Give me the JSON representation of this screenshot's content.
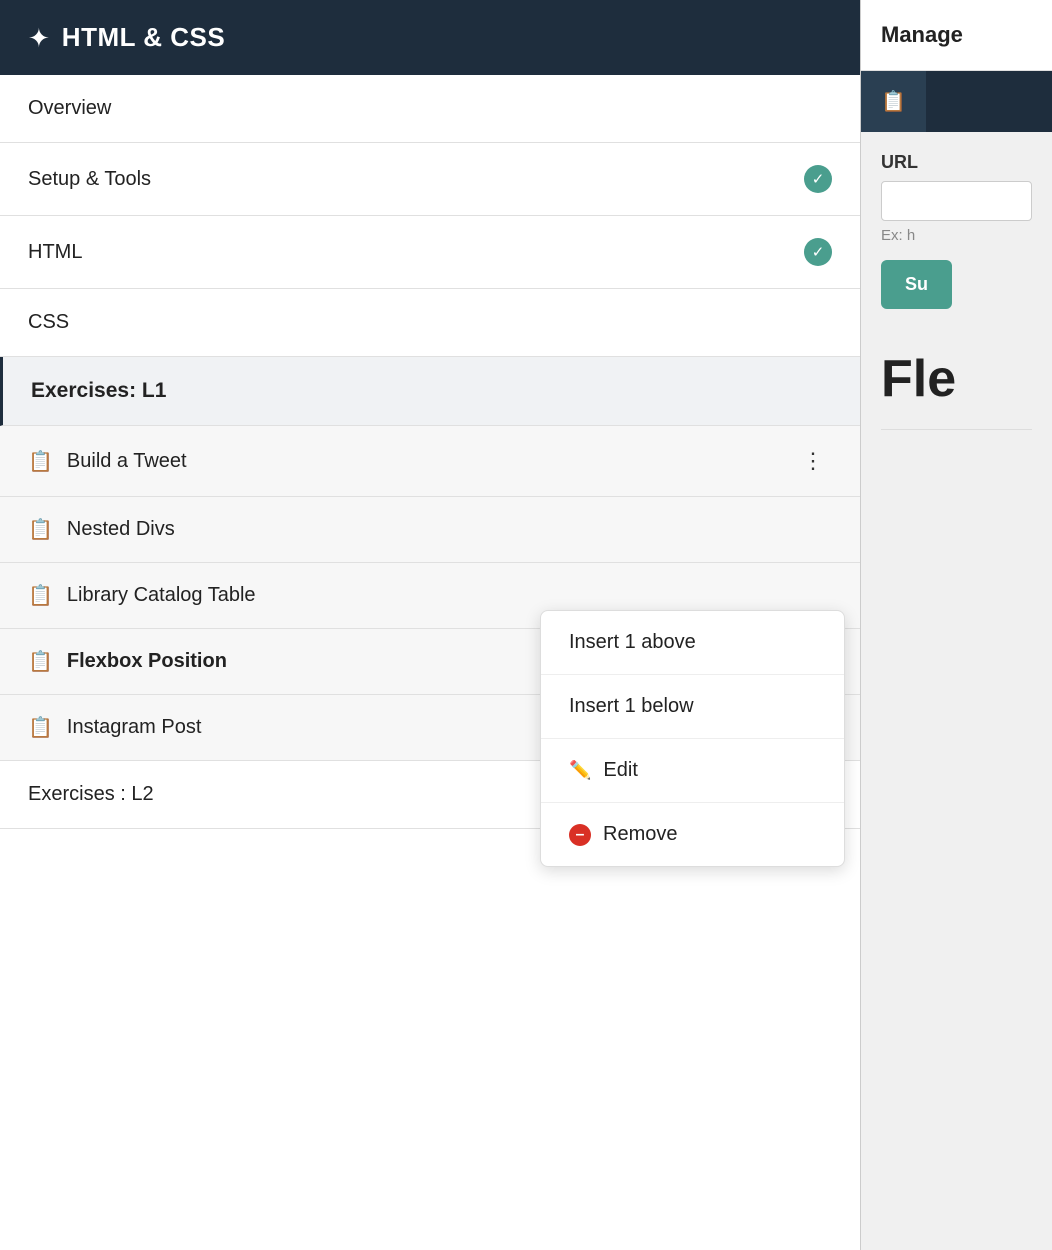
{
  "header": {
    "star_icon": "✦",
    "title": "HTML & CSS"
  },
  "nav_items": [
    {
      "id": "overview",
      "label": "Overview",
      "check": false,
      "active": false
    },
    {
      "id": "setup-tools",
      "label": "Setup & Tools",
      "check": true,
      "active": false
    },
    {
      "id": "html",
      "label": "HTML",
      "check": true,
      "active": false
    },
    {
      "id": "css",
      "label": "CSS",
      "check": false,
      "active": false
    }
  ],
  "exercises_section": {
    "label": "Exercises: L1",
    "active": true
  },
  "exercise_items": [
    {
      "id": "build-tweet",
      "label": "Build a Tweet",
      "bold": false,
      "show_dots": true
    },
    {
      "id": "nested-divs",
      "label": "Nested Divs",
      "bold": false,
      "show_dots": false
    },
    {
      "id": "library-catalog",
      "label": "Library Catalog Table",
      "bold": false,
      "show_dots": false
    },
    {
      "id": "flexbox-position",
      "label": "Flexbox Position",
      "bold": true,
      "show_dots": false
    },
    {
      "id": "instagram-post",
      "label": "Instagram Post",
      "bold": false,
      "show_dots": false
    }
  ],
  "exercises_l2": {
    "label": "Exercises : L2"
  },
  "context_menu": {
    "items": [
      {
        "id": "insert-above",
        "label": "Insert 1 above",
        "icon": "none"
      },
      {
        "id": "insert-below",
        "label": "Insert 1 below",
        "icon": "none"
      },
      {
        "id": "edit",
        "label": "Edit",
        "icon": "pencil"
      },
      {
        "id": "remove",
        "label": "Remove",
        "icon": "remove"
      }
    ]
  },
  "right_panel": {
    "header_label": "Manage",
    "tab_icon": "📋",
    "url_label": "URL",
    "url_placeholder": "",
    "url_hint": "Ex: h",
    "submit_label": "Su",
    "section_title": "Fle"
  }
}
